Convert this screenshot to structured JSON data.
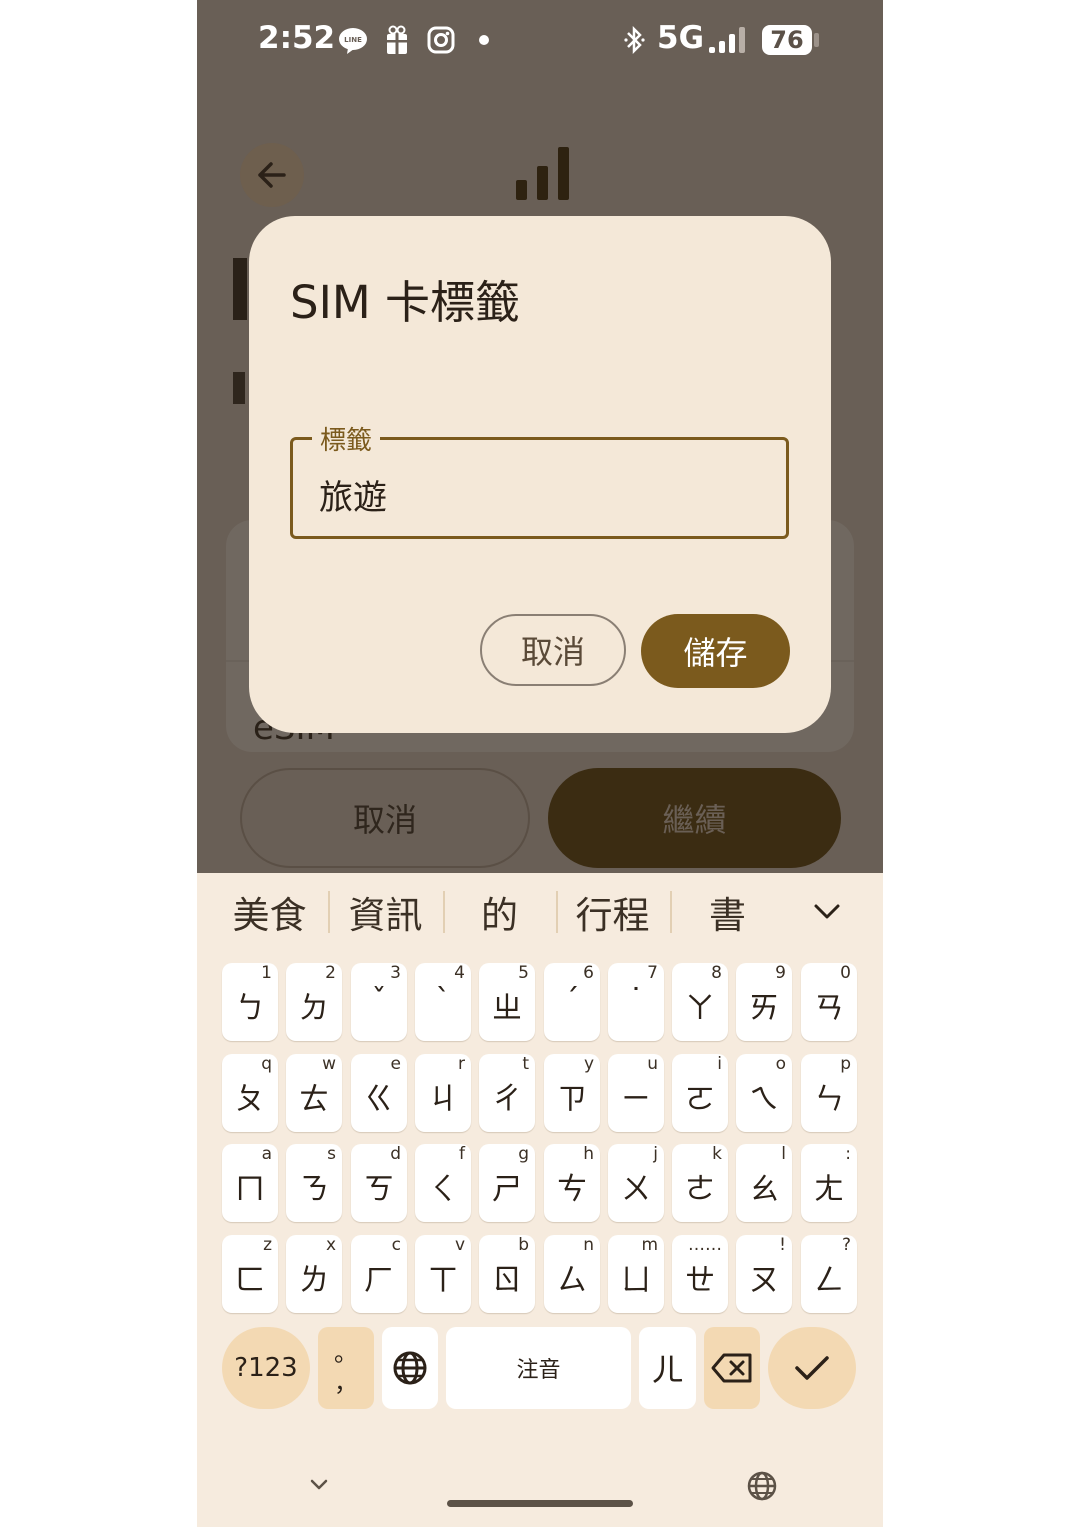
{
  "status_bar": {
    "time": "2:52",
    "network": "5G",
    "battery": "76",
    "icons": [
      "line-icon",
      "gift-icon",
      "instagram-icon",
      "dot-icon",
      "bluetooth-icon",
      "signal-icon"
    ]
  },
  "background_app": {
    "esim_text": "eSIM",
    "cancel_label": "取消",
    "continue_label": "繼續"
  },
  "dialog": {
    "title": "SIM 卡標籤",
    "field_label": "標籤",
    "field_value": "旅遊",
    "cancel_label": "取消",
    "save_label": "儲存"
  },
  "keyboard": {
    "suggestions": [
      "美食",
      "資訊",
      "的",
      "行程",
      "書"
    ],
    "rows": [
      [
        [
          "ㄅ",
          "1"
        ],
        [
          "ㄉ",
          "2"
        ],
        [
          "ˇ",
          "3"
        ],
        [
          "ˋ",
          "4"
        ],
        [
          "ㄓ",
          "5"
        ],
        [
          "ˊ",
          "6"
        ],
        [
          "˙",
          "7"
        ],
        [
          "ㄚ",
          "8"
        ],
        [
          "ㄞ",
          "9"
        ],
        [
          "ㄢ",
          "0"
        ]
      ],
      [
        [
          "ㄆ",
          "q"
        ],
        [
          "ㄊ",
          "w"
        ],
        [
          "ㄍ",
          "e"
        ],
        [
          "ㄐ",
          "r"
        ],
        [
          "ㄔ",
          "t"
        ],
        [
          "ㄗ",
          "y"
        ],
        [
          "ㄧ",
          "u"
        ],
        [
          "ㄛ",
          "i"
        ],
        [
          "ㄟ",
          "o"
        ],
        [
          "ㄣ",
          "p"
        ]
      ],
      [
        [
          "ㄇ",
          "a"
        ],
        [
          "ㄋ",
          "s"
        ],
        [
          "ㄎ",
          "d"
        ],
        [
          "ㄑ",
          "f"
        ],
        [
          "ㄕ",
          "g"
        ],
        [
          "ㄘ",
          "h"
        ],
        [
          "ㄨ",
          "j"
        ],
        [
          "ㄜ",
          "k"
        ],
        [
          "ㄠ",
          "l"
        ],
        [
          "ㄤ",
          ":"
        ]
      ],
      [
        [
          "ㄈ",
          "z"
        ],
        [
          "ㄌ",
          "x"
        ],
        [
          "ㄏ",
          "c"
        ],
        [
          "ㄒ",
          "v"
        ],
        [
          "ㄖ",
          "b"
        ],
        [
          "ㄙ",
          "n"
        ],
        [
          "ㄩ",
          "m"
        ],
        [
          "ㄝ",
          "……"
        ],
        [
          "ㄡ",
          "!"
        ],
        [
          "ㄥ",
          "?"
        ]
      ]
    ],
    "sym_label": "?123",
    "punct_top": "。",
    "punct_bottom": "，",
    "space_label": "注音",
    "er_label": "ㄦ"
  }
}
